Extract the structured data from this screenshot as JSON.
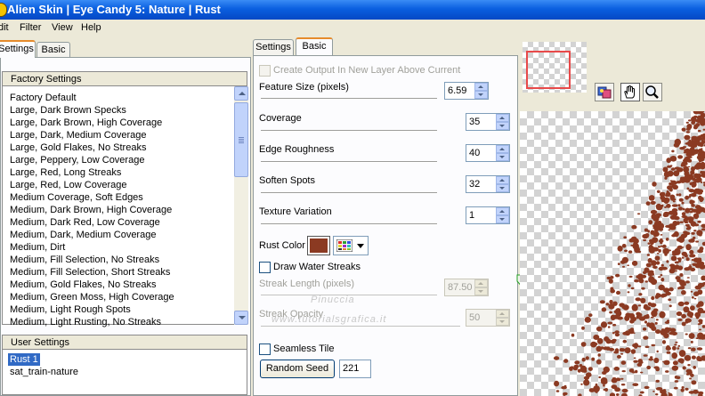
{
  "window": {
    "title": "Alien Skin | Eye Candy 5: Nature | Rust"
  },
  "menu": {
    "items": [
      "Edit",
      "Filter",
      "View",
      "Help"
    ],
    "visible_labels": [
      "dit",
      "Filter",
      "View",
      "Help"
    ]
  },
  "left_tabs": [
    "Settings",
    "Basic"
  ],
  "left_tab_labels": {
    "settings": "Settings",
    "basic": "Basic"
  },
  "factory_settings": {
    "header": "Factory Settings",
    "items": [
      "Factory Default",
      "Large, Dark Brown Specks",
      "Large, Dark Brown, High Coverage",
      "Large, Dark, Medium Coverage",
      "Large, Gold Flakes, No Streaks",
      "Large, Peppery, Low Coverage",
      "Large, Red, Long Streaks",
      "Large, Red, Low Coverage",
      "Medium Coverage, Soft Edges",
      "Medium, Dark Brown, High Coverage",
      "Medium, Dark Red, Low Coverage",
      "Medium, Dark, Medium Coverage",
      "Medium, Dirt",
      "Medium, Fill Selection, No Streaks",
      "Medium, Fill Selection, Short Streaks",
      "Medium, Gold Flakes, No Streaks",
      "Medium, Green Moss, High Coverage",
      "Medium, Light Rough Spots",
      "Medium, Light Rusting, No Streaks"
    ]
  },
  "user_settings": {
    "header": "User Settings",
    "items": [
      "Rust 1",
      "sat_train-nature"
    ],
    "selected": "Rust 1"
  },
  "mid_tabs": {
    "settings": "Settings",
    "basic": "Basic"
  },
  "controls": {
    "create_output": {
      "label": "Create Output In New Layer Above Current",
      "checked": false,
      "enabled": false
    },
    "feature_size": {
      "label": "Feature Size (pixels)",
      "value": "6.59",
      "slider": 0.08
    },
    "coverage": {
      "label": "Coverage",
      "value": "35",
      "slider": 0.35
    },
    "edge_roughness": {
      "label": "Edge Roughness",
      "value": "40",
      "slider": 0.4
    },
    "soften_spots": {
      "label": "Soften Spots",
      "value": "32",
      "slider": 0.32
    },
    "texture_variation": {
      "label": "Texture Variation",
      "value": "1",
      "slider": 0.01
    },
    "rust_color": {
      "label": "Rust Color",
      "color": "#8b3a22"
    },
    "draw_water_streaks": {
      "label": "Draw Water Streaks",
      "checked": false
    },
    "streak_length": {
      "label": "Streak Length (pixels)",
      "value": "87.50",
      "slider": 0.6,
      "enabled": false
    },
    "streak_opacity": {
      "label": "Streak Opacity",
      "value": "50",
      "slider": 1.0,
      "enabled": false
    },
    "seamless_tile": {
      "label": "Seamless Tile",
      "checked": false
    },
    "random_seed": {
      "label": "Random Seed",
      "value": "221"
    }
  },
  "watermark": {
    "line1": "Pinuccia",
    "line2": "www.tutorialsgrafica.it"
  },
  "icons": {
    "app": "alien-skin-icon",
    "hand": "hand-tool-icon",
    "zoom": "zoom-tool-icon",
    "compare": "compare-icon",
    "palette": "color-palette-icon"
  },
  "colors": {
    "titlebar": "#0a5fe0",
    "rust": "#8b3a22",
    "selection": "#316ac5"
  }
}
